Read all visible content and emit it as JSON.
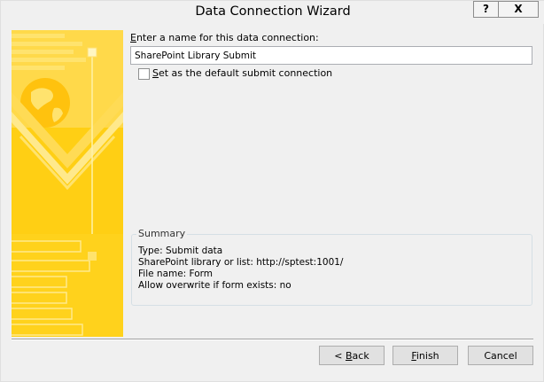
{
  "window": {
    "title": "Data Connection Wizard",
    "help_label": "?",
    "close_label": "X"
  },
  "form": {
    "name_label_accel": "E",
    "name_label_rest": "nter a name for this data connection:",
    "name_value": "SharePoint Library Submit",
    "default_label_accel": "S",
    "default_label_rest": "et as the default submit connection",
    "default_checked": false
  },
  "summary": {
    "title": "Summary",
    "lines": [
      "Type: Submit data",
      "SharePoint library or list: http://sptest:1001/",
      "File name: Form",
      "Allow overwrite if form exists: no"
    ]
  },
  "buttons": {
    "back_prefix": "< ",
    "back_accel": "B",
    "back_rest": "ack",
    "finish_accel": "F",
    "finish_rest": "inish",
    "cancel_label": "Cancel"
  },
  "colors": {
    "side_panel_base": "#ffd21c",
    "side_panel_light": "#ffe97a",
    "side_panel_pale": "#fff3b0"
  }
}
